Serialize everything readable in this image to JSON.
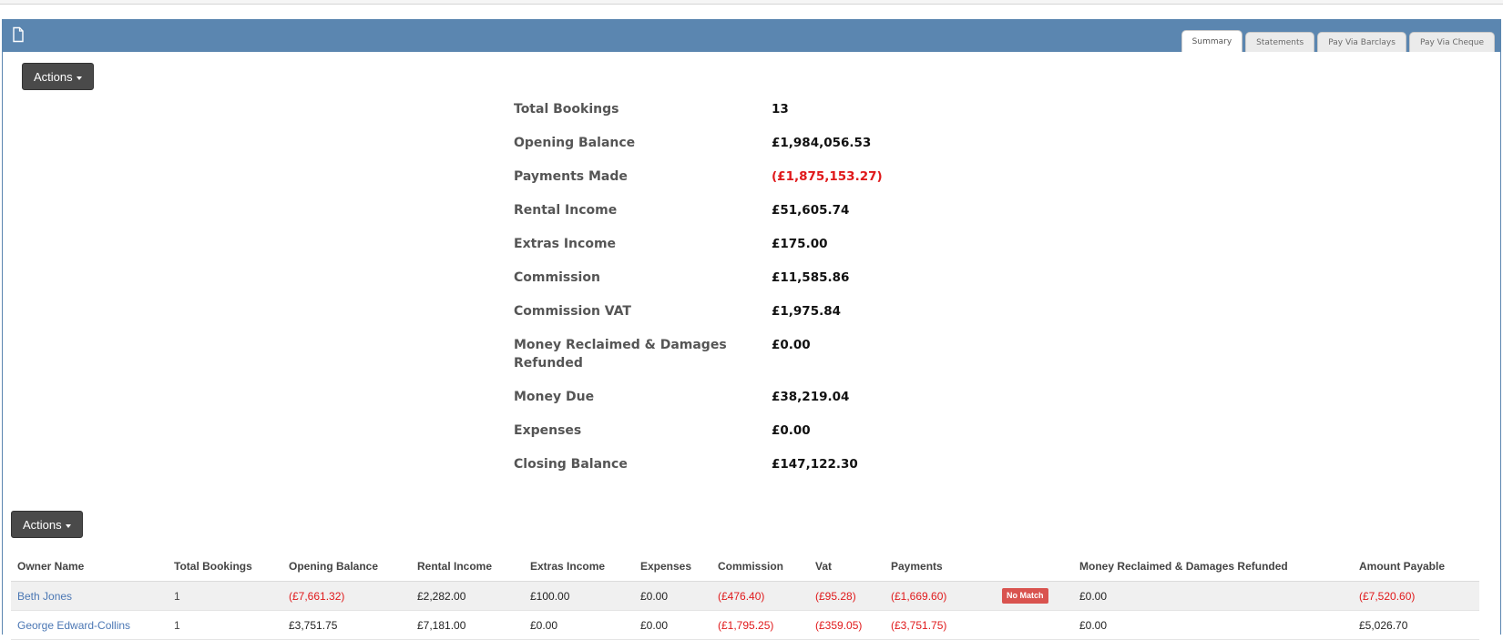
{
  "tabs": [
    {
      "label": "Summary",
      "active": true
    },
    {
      "label": "Statements",
      "active": false
    },
    {
      "label": "Pay Via Barclays",
      "active": false
    },
    {
      "label": "Pay Via Cheque",
      "active": false
    }
  ],
  "actions_top": "Actions",
  "actions_bottom": "Actions",
  "summary": [
    {
      "label": "Total Bookings",
      "value": "13"
    },
    {
      "label": "Opening Balance",
      "value": "£1,984,056.53"
    },
    {
      "label": "Payments Made",
      "value": "(£1,875,153.27)",
      "negative": true
    },
    {
      "label": "Rental Income",
      "value": "£51,605.74"
    },
    {
      "label": "Extras Income",
      "value": "£175.00"
    },
    {
      "label": "Commission",
      "value": "£11,585.86"
    },
    {
      "label": "Commission VAT",
      "value": "£1,975.84"
    },
    {
      "label": "Money Reclaimed & Damages Refunded",
      "value": "£0.00"
    },
    {
      "label": "Money Due",
      "value": "£38,219.04"
    },
    {
      "label": "Expenses",
      "value": "£0.00"
    },
    {
      "label": "Closing Balance",
      "value": "£147,122.30"
    }
  ],
  "table": {
    "headers": [
      "Owner Name",
      "Total Bookings",
      "Opening Balance",
      "Rental Income",
      "Extras Income",
      "Expenses",
      "Commission",
      "Vat",
      "Payments",
      "",
      "Money Reclaimed & Damages Refunded",
      "Amount Payable"
    ],
    "rows": [
      {
        "owner": "Beth Jones",
        "bookings": "1",
        "opening": "(£7,661.32)",
        "rental": "£2,282.00",
        "extras": "£100.00",
        "expenses": "£0.00",
        "commission": "(£476.40)",
        "vat": "(£95.28)",
        "payments": "(£1,669.60)",
        "status": "No Match",
        "reclaimed": "£0.00",
        "payable": "(£7,520.60)"
      },
      {
        "owner": "George Edward-Collins",
        "bookings": "1",
        "opening": "£3,751.75",
        "rental": "£7,181.00",
        "extras": "£0.00",
        "expenses": "£0.00",
        "commission": "(£1,795.25)",
        "vat": "(£359.05)",
        "payments": "(£3,751.75)",
        "status": "",
        "reclaimed": "£0.00",
        "payable": "£5,026.70"
      }
    ]
  },
  "colors": {
    "header_bar": "#5b86b0",
    "negative": "#e0191b",
    "link": "#4b77b4",
    "badge": "#d9534f",
    "button": "#4a4a4a"
  }
}
